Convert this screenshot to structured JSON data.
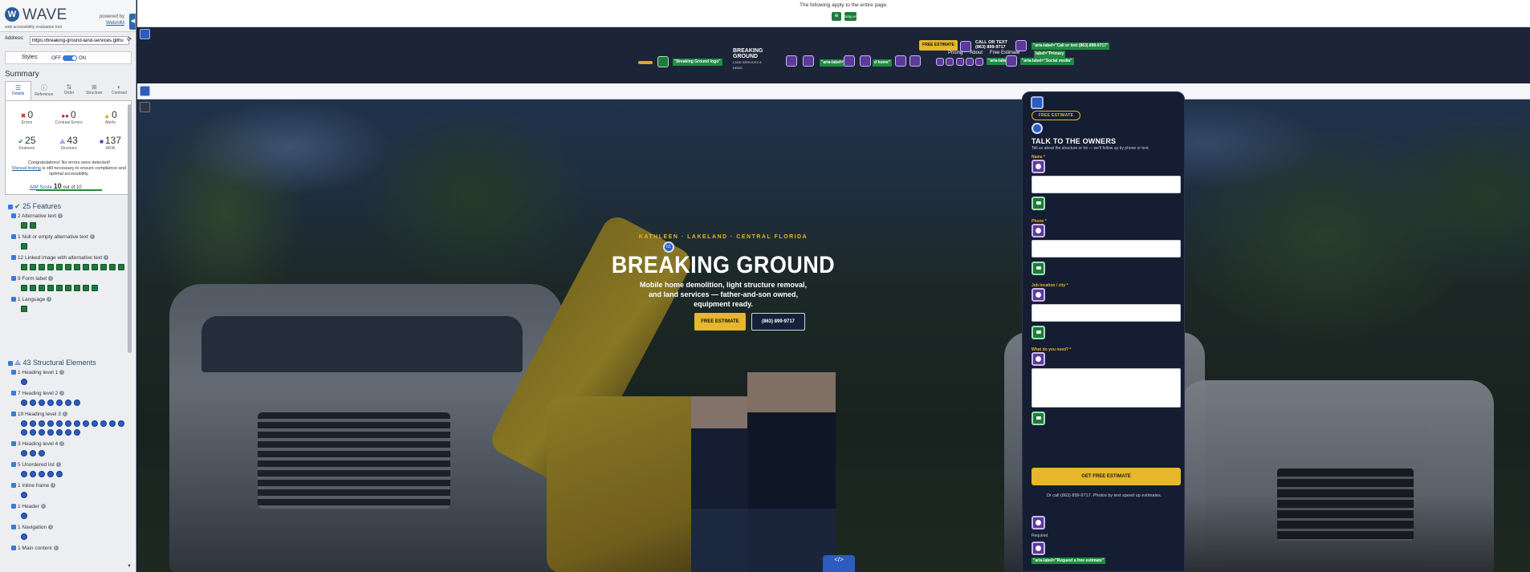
{
  "wave": {
    "title": "WAVE",
    "subtitle": "web accessibility evaluation tool",
    "powered_by": "powered by",
    "webaim": "WebAIM",
    "address_label": "Address:",
    "address_value": "https://breaking-ground-land-services.githu",
    "styles_label": "Styles:",
    "styles_off": "OFF",
    "styles_on": "ON",
    "summary_heading": "Summary",
    "tabs": [
      "Details",
      "Reference",
      "Order",
      "Structure",
      "Contrast"
    ],
    "errors": {
      "count": "0",
      "label": "Errors"
    },
    "contrast_errors": {
      "count": "0",
      "label": "Contrast Errors"
    },
    "alerts": {
      "count": "0",
      "label": "Alerts"
    },
    "features": {
      "count": "25",
      "label": "Features"
    },
    "structure": {
      "count": "43",
      "label": "Structure"
    },
    "aria": {
      "count": "137",
      "label": "ARIA"
    },
    "congrats_1": "Congratulations! No errors were detected!",
    "manual_testing": "Manual testing",
    "congrats_2": "is still necessary to ensure compliance and optimal accessibility.",
    "aim_label": "AIM Score",
    "aim_score": "10",
    "aim_outof": "out of 10",
    "features_heading": "25 Features",
    "structure_heading": "43 Structural Elements",
    "feature_items": [
      {
        "label": "2 Alternative text",
        "icons": 2
      },
      {
        "label": "1 Null or empty alternative text",
        "icons": 1
      },
      {
        "label": "12 Linked image with alternative text",
        "icons": 12
      },
      {
        "label": "9 Form label",
        "icons": 9
      },
      {
        "label": "1 Language",
        "icons": 1
      }
    ],
    "structure_items": [
      {
        "label": "1 Heading level 1",
        "icons": 1
      },
      {
        "label": "7 Heading level 2",
        "icons": 7
      },
      {
        "label": "19 Heading level 3",
        "icons": 19
      },
      {
        "label": "3 Heading level 4",
        "icons": 3
      },
      {
        "label": "5 Unordered list",
        "icons": 5
      },
      {
        "label": "1 Inline frame",
        "icons": 1
      },
      {
        "label": "1 Header",
        "icons": 1
      },
      {
        "label": "1 Navigation",
        "icons": 1
      },
      {
        "label": "1 Main content",
        "icons": 0
      }
    ],
    "accent_color": "#2d6ab0"
  },
  "page": {
    "top_message": "The following apply to the entire page.",
    "lang_tag": "lang=en",
    "header": {
      "logo_alt_tag": "\"Breaking Ground logo\"",
      "logo_name": "BREAKING GROUND",
      "logo_sub": "LAND SERVICES & DEMO",
      "aria_label_1": "\"aria-label=\"",
      "aria_label_home": "d home\"",
      "free_estimate": "FREE ESTIMATE",
      "call_or_text": "CALL OR TEXT",
      "phone": "(863) 899-9717",
      "aria_call": "\"aria-label=\"Call or text (863) 899-9717\"",
      "aria_primary": "label=\"Primary",
      "aria_social": "\"aria-label=\"Social media\"",
      "nav": [
        "Pricing",
        "About",
        "Free Estimate"
      ],
      "aria_other": "\"aria-label=\"",
      "aria_other_2": "label=\""
    },
    "hero": {
      "eyebrow": "KATHLEEN · LAKELAND · CENTRAL FLORIDA",
      "title": "BREAKING GROUND",
      "subtitle": "Mobile home demolition, light structure removal, and land services — father-and-son owned, equipment ready.",
      "cta_primary": "FREE ESTIMATE",
      "cta_secondary": "(863) 899-9717",
      "h1_badge": "h1",
      "code_badge": "</>"
    },
    "form": {
      "badge": "FREE ESTIMATE",
      "heading": "TALK TO THE OWNERS",
      "intro": "Tell us about the structure or lot — we'll follow up by phone or text.",
      "name_label": "Name *",
      "phone_label": "Phone *",
      "location_label": "Job location / city *",
      "need_label": "What do you need? *",
      "submit": "GET FREE ESTIMATE",
      "footer": "Or call (863) 899-9717. Photos by text speed up estimates.",
      "required": "Required",
      "aria_tag": "\"aria-label=\"Request a free estimate\""
    },
    "colors": {
      "brand_yellow": "#e8b62c",
      "navy": "#151d33",
      "wave_feature": "#1e7a3a",
      "wave_aria": "#5b3a9a",
      "wave_structure": "#2d5bc0"
    }
  }
}
